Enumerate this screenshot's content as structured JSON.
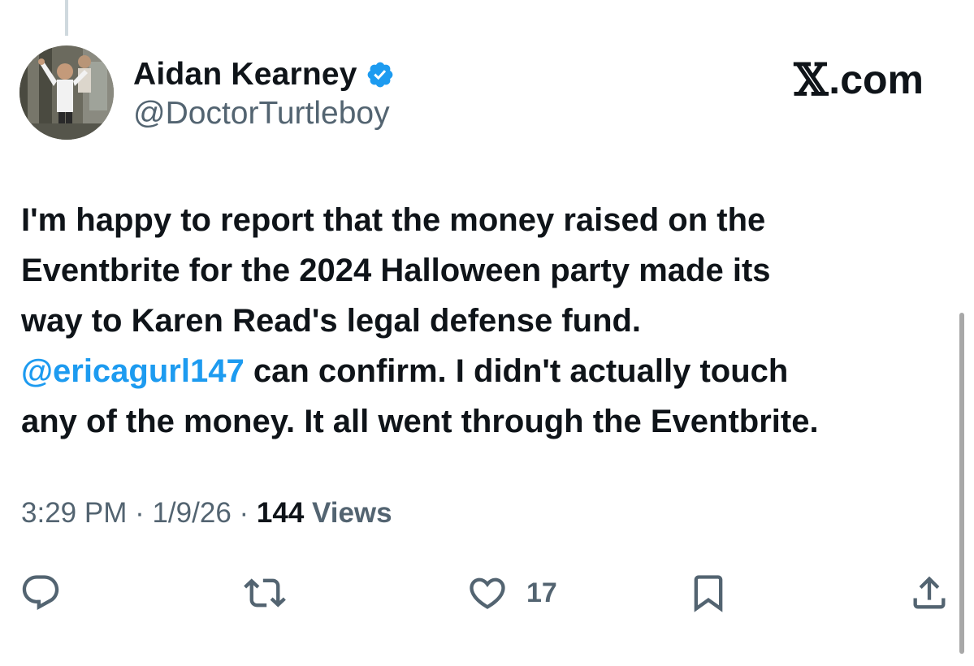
{
  "author": {
    "display_name": "Aidan Kearney",
    "handle": "@DoctorTurtleboy",
    "verified": true,
    "verified_color": "#1d9bf0"
  },
  "brand": {
    "x_glyph": "𝕏",
    "suffix": ".com"
  },
  "tweet": {
    "line1": "I'm happy to report that the money raised on the",
    "line2": "Eventbrite for the 2024 Halloween party made its",
    "line3": "way to Karen Read's legal defense fund.",
    "line4_mention": "@ericagurl147",
    "line4_rest": " can confirm. I didn't actually touch",
    "line5": "any of the money. It all went through the Eventbrite.",
    "mention_color": "#1d9bf0"
  },
  "meta": {
    "time": "3:29 PM",
    "separator": " · ",
    "date": "1/9/26",
    "views_count": "144",
    "views_label": " Views"
  },
  "actions": {
    "reply_icon": "reply-icon",
    "retweet_icon": "retweet-icon",
    "like_icon": "heart-icon",
    "like_count": "17",
    "bookmark_icon": "bookmark-icon",
    "share_icon": "share-icon"
  }
}
